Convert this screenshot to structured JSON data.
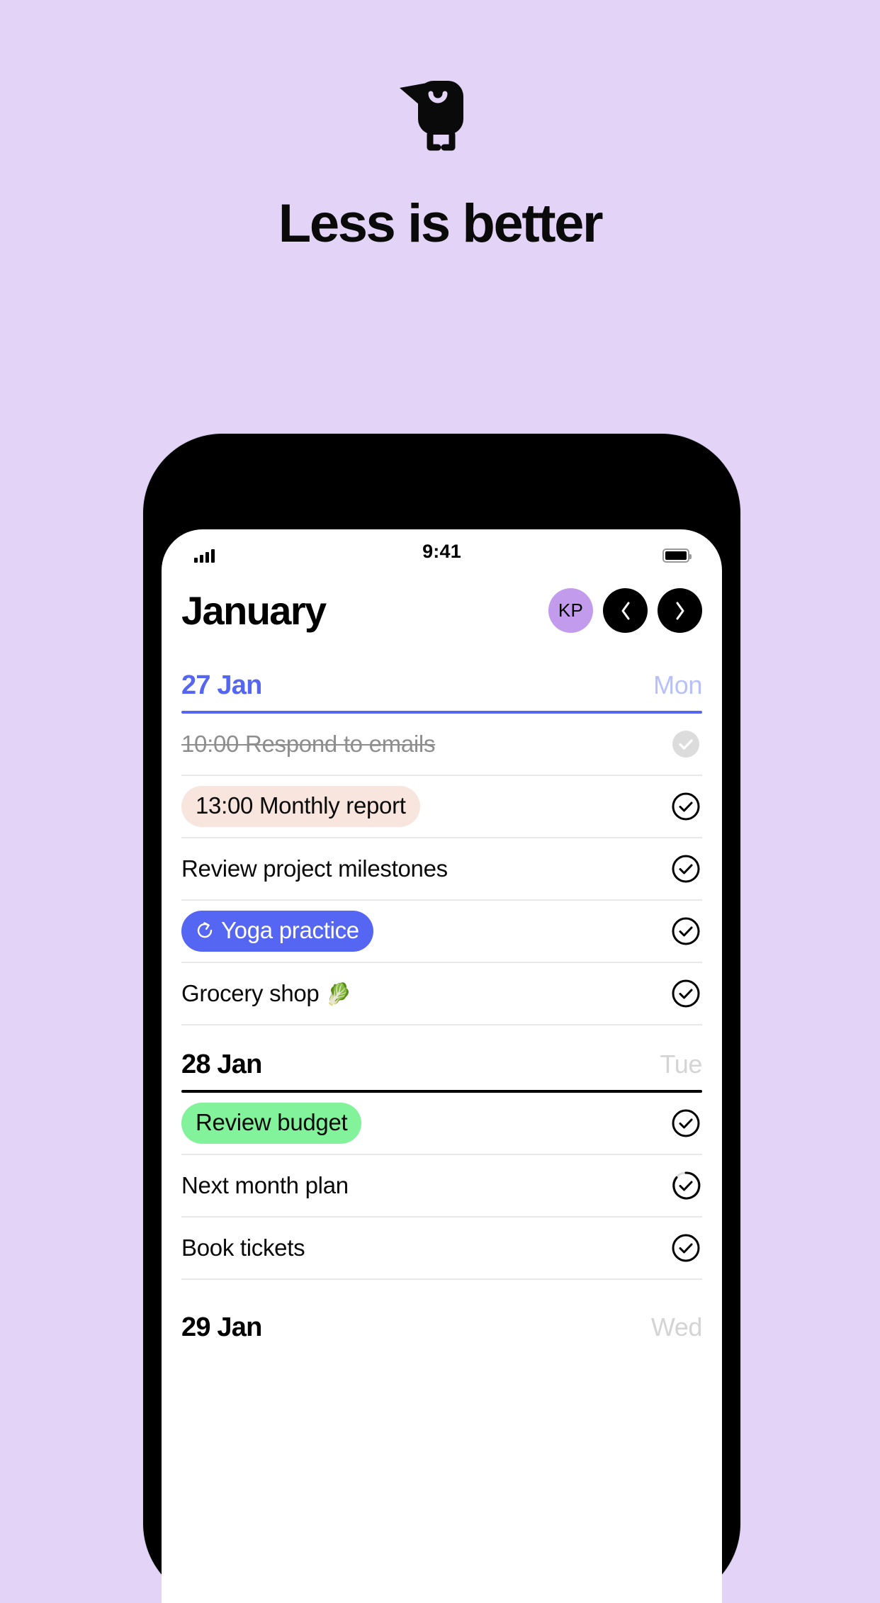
{
  "hero": {
    "logo_icon": "bird-logo-icon",
    "headline": "Less is better",
    "background_color": "#e3d4f7"
  },
  "phone": {
    "status_bar": {
      "signal_icon": "signal-bars-icon",
      "time": "9:41",
      "battery_icon": "battery-icon"
    },
    "header": {
      "title": "January",
      "avatar_initials": "KP",
      "avatar_color": "#c39bec",
      "prev_label": "chevron-left-icon",
      "next_label": "chevron-right-icon"
    },
    "days": [
      {
        "date": "27 Jan",
        "dow": "Mon",
        "accent": true,
        "accent_color": "#5566f2",
        "tasks": [
          {
            "label": "10:00 Respond to emails",
            "state": "done",
            "style": "plain",
            "check": "filled-gray"
          },
          {
            "label": "13:00 Monthly report",
            "state": "open",
            "style": "pill-pink",
            "check": "outline"
          },
          {
            "label": "Review project milestones",
            "state": "open",
            "style": "plain",
            "check": "outline"
          },
          {
            "label": "Yoga practice",
            "state": "open",
            "style": "pill-blue",
            "check": "outline",
            "icon": "repeat-icon"
          },
          {
            "label": "Grocery shop",
            "state": "open",
            "style": "plain",
            "check": "outline",
            "emoji": "🥬"
          }
        ]
      },
      {
        "date": "28 Jan",
        "dow": "Tue",
        "accent": false,
        "tasks": [
          {
            "label": "Review budget",
            "state": "open",
            "style": "pill-green",
            "check": "outline"
          },
          {
            "label": "Next month plan",
            "state": "open",
            "style": "plain",
            "check": "progress"
          },
          {
            "label": "Book tickets",
            "state": "open",
            "style": "plain",
            "check": "outline"
          }
        ]
      },
      {
        "date": "29 Jan",
        "dow": "Wed",
        "accent": false,
        "tasks": []
      }
    ]
  }
}
